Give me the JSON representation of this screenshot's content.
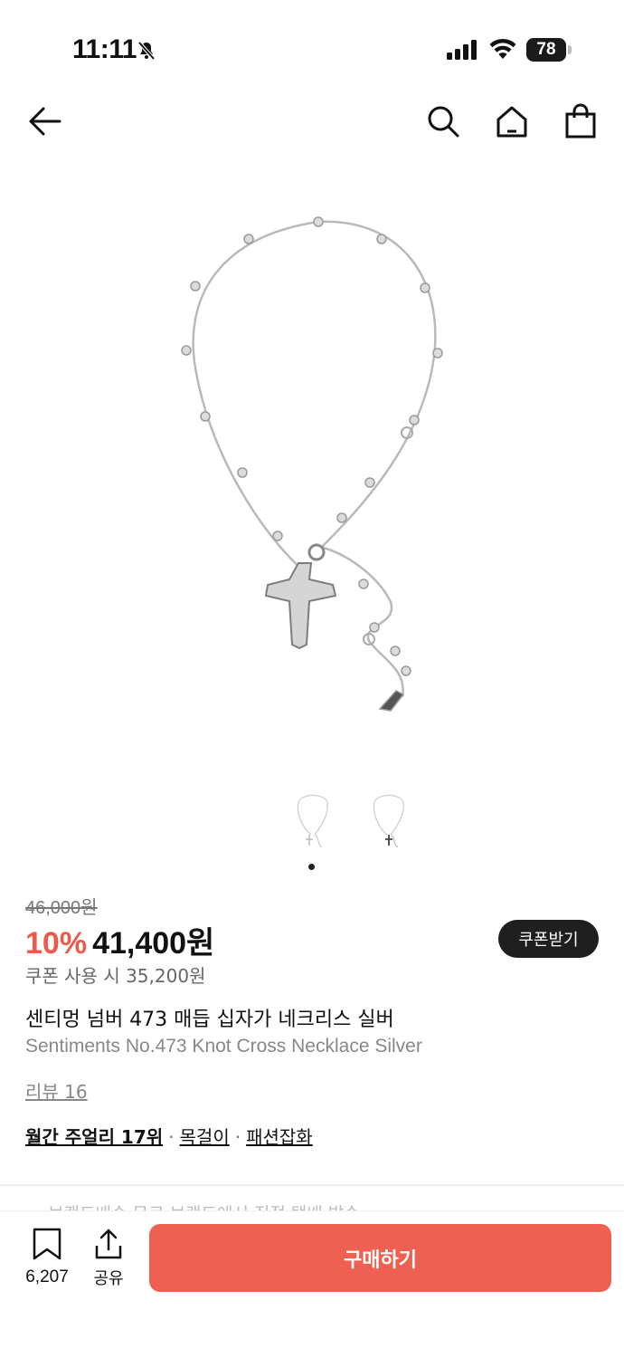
{
  "status_bar": {
    "time": "11:11",
    "battery": "78"
  },
  "nav": {
    "back_icon": "arrow-left-icon",
    "search_icon": "search-icon",
    "home_icon": "home-icon",
    "cart_icon": "shopping-bag-icon"
  },
  "product": {
    "original_price": "46,000원",
    "discount": "10%",
    "price": "41,400원",
    "coupon_button": "쿠폰받기",
    "coupon_price": "쿠폰 사용 시 35,200원",
    "title_ko": "센티멍 넘버 473 매듭 십자가 네크리스 실버",
    "title_en": "Sentiments No.473 Knot Cross Necklace Silver",
    "review": "리뷰 16",
    "rank": "월간 주얼리 17위",
    "category_1": "목걸이",
    "category_2": "패션잡화",
    "separator": "·"
  },
  "partial_text": "— 브랜드배송 무료 브랜드에서 직접 택배 발송",
  "bottom_bar": {
    "save_count": "6,207",
    "share_label": "공유",
    "buy_label": "구매하기"
  },
  "colors": {
    "accent": "#ee6152",
    "discount": "#ec5a4a",
    "dark_button": "#1f1f1f"
  }
}
